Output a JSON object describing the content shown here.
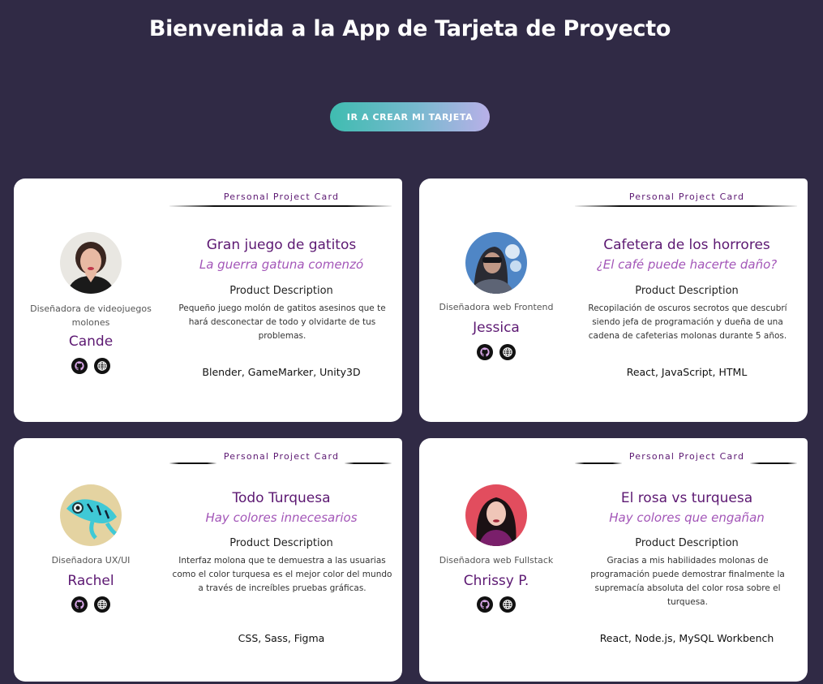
{
  "page": {
    "title": "Bienvenida a la App de Tarjeta de Proyecto",
    "cta_label": "IR A CREAR MI TARJETA"
  },
  "colors": {
    "background": "#302a45",
    "accent_purple": "#5c1872",
    "slogan_purple": "#a356b8",
    "button_gradient_start": "#3fbcb0",
    "button_gradient_end": "#b9b0e8"
  },
  "cards": [
    {
      "tag": "Personal Project Card",
      "avatar_icon": "avatar-short-dark-hair-woman",
      "job": "Diseñadora de videojuegos molones",
      "author": "Cande",
      "links": [
        "github-icon",
        "globe-icon"
      ],
      "project_name": "Gran juego de gatitos",
      "slogan": "La guerra gatuna comenzó",
      "desc_title": "Product Description",
      "desc": "Pequeño juego molón de gatitos asesinos que te hará desconectar de todo y olvidarte de tus problemas.",
      "technologies": "Blender, GameMarker, Unity3D"
    },
    {
      "tag": "Personal Project Card",
      "avatar_icon": "avatar-sunglasses-woman",
      "job": "Diseñadora web Frontend",
      "author": "Jessica",
      "links": [
        "github-icon",
        "globe-icon"
      ],
      "project_name": "Cafetera de los horrores",
      "slogan": "¿El café puede hacerte daño?",
      "desc_title": "Product Description",
      "desc": "Recopilación de oscuros secrotos que descubrí siendo jefa de programación y dueña de una cadena de cafeterias molonas durante 5 años.",
      "technologies": "React, JavaScript, HTML"
    },
    {
      "tag": "Personal Project Card",
      "avatar_icon": "avatar-turquoise-gecko",
      "job": "Diseñadora UX/UI",
      "author": "Rachel",
      "links": [
        "github-icon",
        "globe-icon"
      ],
      "project_name": "Todo Turquesa",
      "slogan": "Hay colores innecesarios",
      "desc_title": "Product Description",
      "desc": "Interfaz molona que te demuestra a las usuarias como el color turquesa es el mejor color del mundo a través de increíbles pruebas gráficas.",
      "technologies": "CSS, Sass, Figma"
    },
    {
      "tag": "Personal Project Card",
      "avatar_icon": "avatar-long-dark-hair-woman",
      "job": "Diseñadora web Fullstack",
      "author": "Chrissy P.",
      "links": [
        "github-icon",
        "globe-icon"
      ],
      "project_name": "El rosa vs turquesa",
      "slogan": "Hay colores que engañan",
      "desc_title": "Product Description",
      "desc": "Gracias a mis habilidades molonas de programación puede demostrar finalmente la supremacía absoluta del color rosa sobre el turquesa.",
      "technologies": "React, Node.js, MySQL Workbench"
    }
  ]
}
